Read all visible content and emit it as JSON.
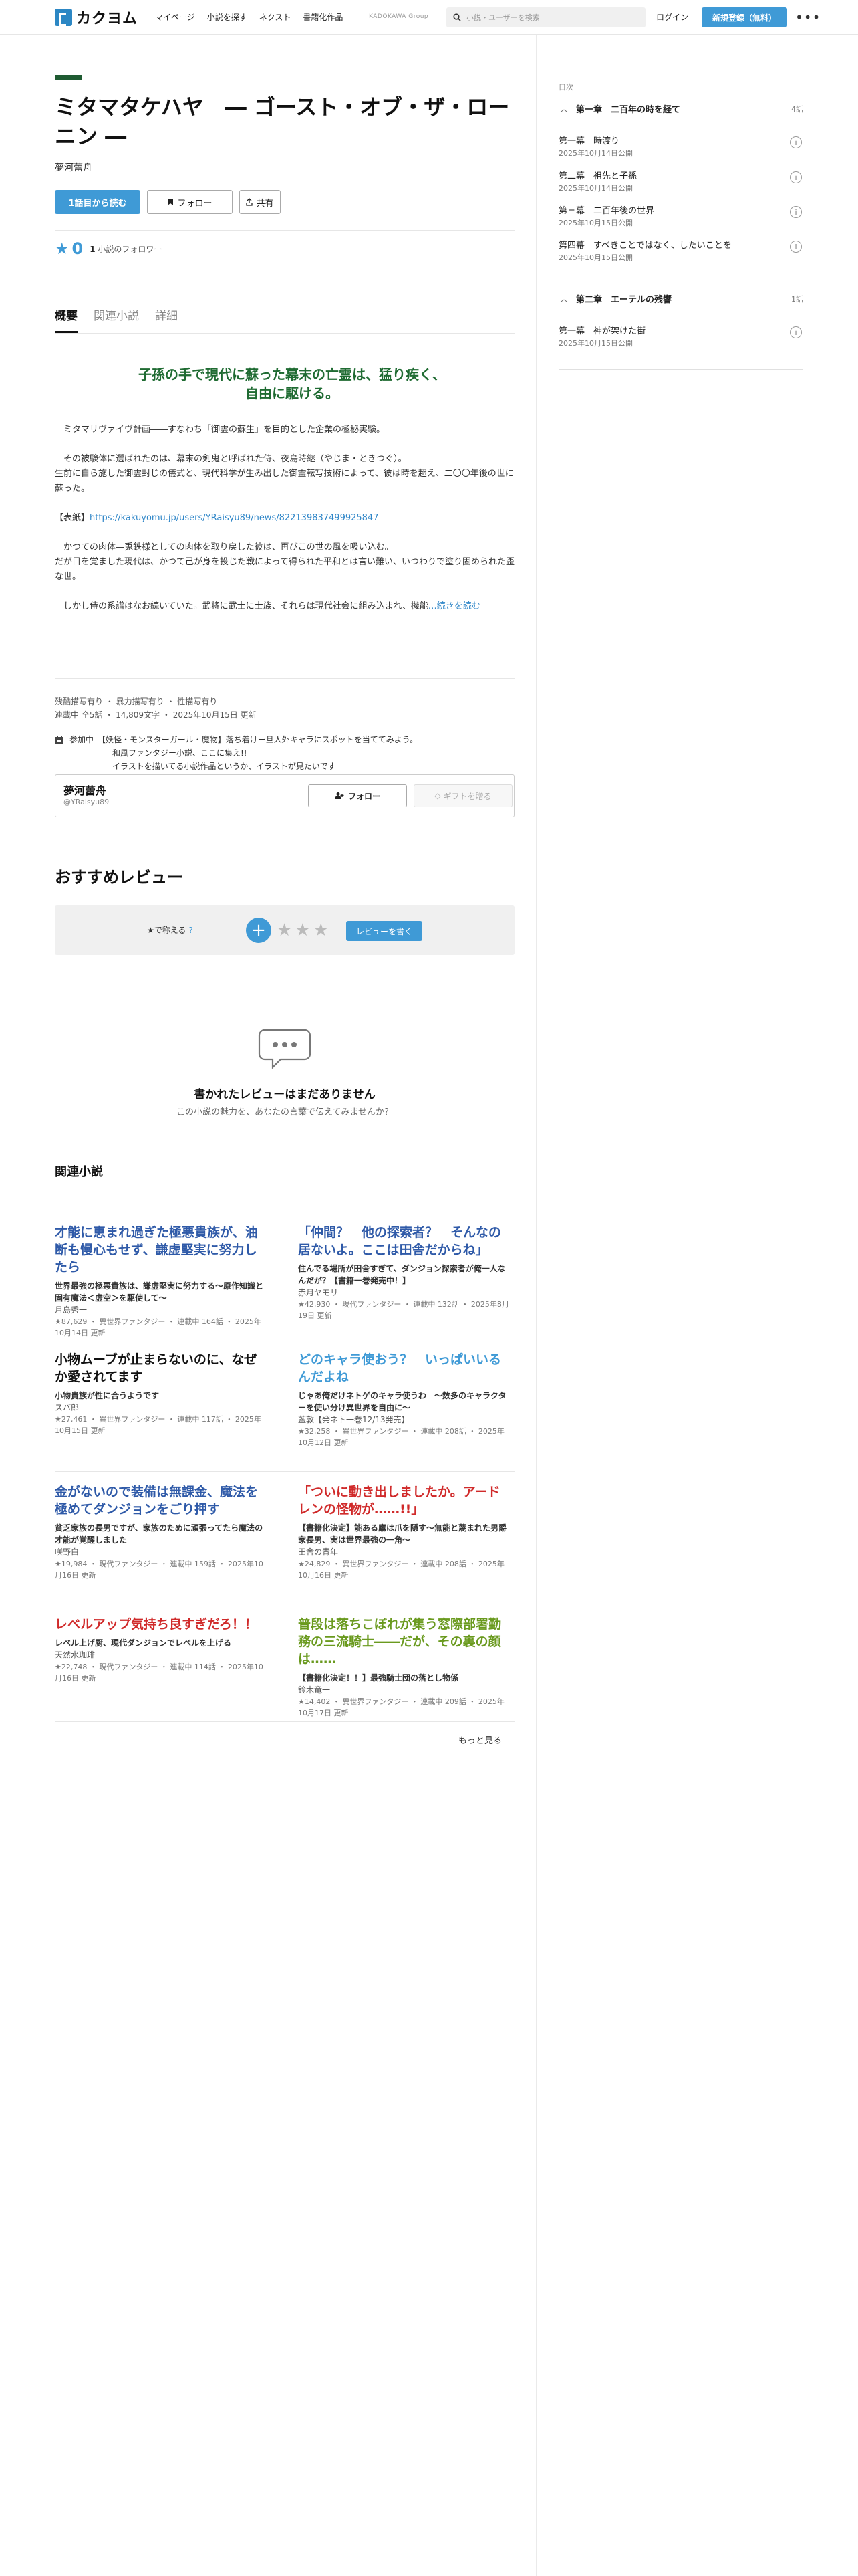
{
  "header": {
    "logo_text": "カクヨム",
    "nav": [
      "マイページ",
      "小説を探す",
      "ネクスト",
      "書籍化作品"
    ],
    "kadokawa": "KADOKAWA Group",
    "search_placeholder": "小説・ユーザーを検索",
    "login": "ログイン",
    "signup": "新規登録（無料）",
    "more": "•••"
  },
  "work": {
    "title": "ミタマタケハヤ　― ゴースト・オブ・ザ・ローニン ―",
    "author": "夢河蕾舟",
    "buttons": {
      "read": "1話目から読む",
      "follow": "フォロー",
      "share": "共有"
    },
    "stars": "0",
    "followers_count": "1",
    "followers_label": "小説のフォロワー",
    "genre_color": "#1f5b32"
  },
  "tabs": [
    "概要",
    "関連小説",
    "詳細"
  ],
  "intro": {
    "catchphrase": "子孫の手で現代に蘇った幕末の亡霊は、猛り疾く、自由に駆ける。",
    "p1": "ミタマリヴァイヴ計画――すなわち「御霊の蘇生」を目的とした企業の極秘実験。",
    "p2a": "その被験体に選ばれたのは、幕末の剣鬼と呼ばれた侍、夜島時継（やじま・ときつぐ）。",
    "p2b": "生前に自ら施した御霊封じの儀式と、現代科学が生み出した御霊転写技術によって、彼は時を超え、二〇〇年後の世に蘇った。",
    "p3_label": "【表紙】",
    "p3_link": "https://kakuyomu.jp/users/YRaisyu89/news/822139837499925847",
    "p4a": "かつての肉体―兎鉄様としての肉体を取り戻した彼は、再びこの世の風を吸い込む。",
    "p4b": "だが目を覚ました現代は、かつて己が身を投じた戦によって得られた平和とは言い難い、いつわりで塗り固められた歪な世。",
    "p5": "しかし侍の系譜はなお続いていた。武将に武士に士族、それらは現代社会に組み込まれ、機能",
    "read_more": "…続きを読む"
  },
  "tags": "残酷描写有り ・ 暴力描写有り ・ 性描写有り",
  "meta": "連載中 全5話 ・ 14,809文字 ・ 2025年10月15日 更新",
  "event": {
    "label": "参加中",
    "line1": "【妖怪・モンスターガール・魔物】落ち着けー旦人外キャラにスポットを当ててみよう。",
    "line2": "和風ファンタジー小説、ここに集え!!",
    "line3": "イラストを描いてる小説作品というか、イラストが見たいです"
  },
  "author_card": {
    "name": "夢河蕾舟",
    "handle": "@YRaisyu89",
    "follow": "フォロー",
    "gift": "ギフトを贈る"
  },
  "reviews": {
    "title": "おすすめレビュー",
    "rate_label": "★で称える",
    "help": "?",
    "plus": "+",
    "stars": "★★★",
    "write": "レビューを書く",
    "empty_title": "書かれたレビューはまだありません",
    "empty_sub": "この小説の魅力を、あなたの言葉で伝えてみませんか？"
  },
  "related": {
    "title": "関連小説",
    "more": "もっと見る",
    "items": [
      {
        "title": "才能に恵まれ過ぎた極悪貴族が、油断も慢心もせず、謙虚堅実に努力したら",
        "color": "#2f5aa8",
        "catch": "世界最強の極悪貴族は、謙虚堅実に努力する～原作知識と固有魔法＜虚空＞を駆使して～",
        "author": "月島秀一",
        "meta": "★87,629 ・ 異世界ファンタジー ・ 連載中 164話 ・ 2025年10月14日 更新"
      },
      {
        "title": "「仲間？　他の探索者？　そんなの居ないよ。ここは田舎だからね」",
        "color": "#2f5aa8",
        "catch": "住んでる場所が田舎すぎて、ダンジョン探索者が俺一人なんだが？【書籍一巻発売中！】",
        "author": "赤月ヤモリ",
        "meta": "★42,930 ・ 現代ファンタジー ・ 連載中 132話 ・ 2025年8月19日 更新"
      },
      {
        "title": "小物ムーブが止まらないのに、なぜか愛されてます",
        "color": "#111111",
        "catch": "小物貴族が性に合うようです",
        "author": "スバ郎",
        "meta": "★27,461 ・ 異世界ファンタジー ・ 連載中 117話 ・ 2025年10月15日 更新"
      },
      {
        "title": "どのキャラ使おう？　いっぱいいるんだよね",
        "color": "#3f9ad6",
        "catch": "じゃあ俺だけネトゲのキャラ使うわ　～数多のキャラクターを使い分け異世界を自由に～",
        "author": "藍敦【発ネト一巻12/13発売】",
        "meta": "★32,258 ・ 異世界ファンタジー ・ 連載中 208話 ・ 2025年10月12日 更新"
      },
      {
        "title": "金がないので装備は無課金、魔法を極めてダンジョンをごり押す",
        "color": "#2f5aa8",
        "catch": "貧乏家族の長男ですが、家族のために頑張ってたら魔法の才能が覚醒しました",
        "author": "咲野白",
        "meta": "★19,984 ・ 現代ファンタジー ・ 連載中 159話 ・ 2025年10月16日 更新"
      },
      {
        "title": "「ついに動き出しましたか。アードレンの怪物が……!!」",
        "color": "#d02a2a",
        "catch": "【書籍化決定】能ある鷹は爪を隠す～無能と蔑まれた男爵家長男、実は世界最強の一角～",
        "author": "田舎の青年",
        "meta": "★24,829 ・ 異世界ファンタジー ・ 連載中 208話 ・ 2025年10月16日 更新"
      },
      {
        "title": "レベルアップ気持ち良すぎだろ！！",
        "color": "#d02a2a",
        "catch": "レベル上げ厨、現代ダンジョンでレベルを上げる",
        "author": "天然水珈琲",
        "meta": "★22,748 ・ 現代ファンタジー ・ 連載中 114話 ・ 2025年10月16日 更新"
      },
      {
        "title": "普段は落ちこぼれが集う窓際部署勤務の三流騎士――だが、その裏の顔は……",
        "color": "#6a9a1f",
        "catch": "【書籍化決定！！】最強騎士団の落とし物係",
        "author": "鈴木竜一",
        "meta": "★14,402 ・ 異世界ファンタジー ・ 連載中 209話 ・ 2025年10月17日 更新"
      }
    ]
  },
  "toc": {
    "label": "目次",
    "chapters": [
      {
        "title": "第一章　二百年の時を経て",
        "count": "4話",
        "episodes": [
          {
            "title": "第一幕　時渡り",
            "date": "2025年10月14日公開"
          },
          {
            "title": "第二幕　祖先と子孫",
            "date": "2025年10月14日公開"
          },
          {
            "title": "第三幕　二百年後の世界",
            "date": "2025年10月15日公開"
          },
          {
            "title": "第四幕　すべきことではなく、したいことを",
            "date": "2025年10月15日公開"
          }
        ]
      },
      {
        "title": "第二章　エーテルの残響",
        "count": "1話",
        "episodes": [
          {
            "title": "第一幕　神が架けた街",
            "date": "2025年10月15日公開"
          }
        ]
      }
    ]
  }
}
